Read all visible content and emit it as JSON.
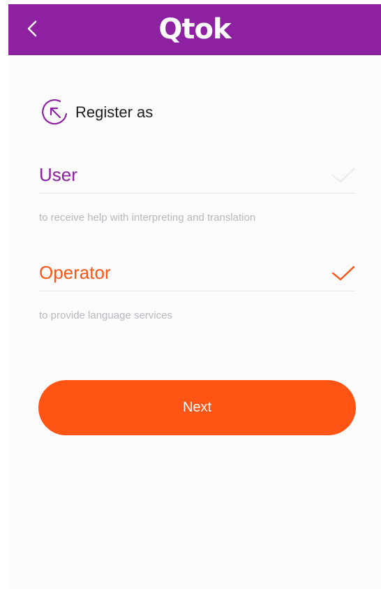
{
  "header": {
    "logo_text": "Qtok",
    "back_icon": "chevron-left-icon",
    "bg_color": "#8d21a2"
  },
  "section": {
    "icon": "arrow-cycle-icon",
    "title": "Register as"
  },
  "options": [
    {
      "label": "User",
      "description": "to receive help with interpreting and translation",
      "selected": false,
      "color": "#8d21a2"
    },
    {
      "label": "Operator",
      "description": "to provide language services",
      "selected": true,
      "color": "#ff5414"
    }
  ],
  "next_button": {
    "label": "Next",
    "color": "#ff5414"
  }
}
